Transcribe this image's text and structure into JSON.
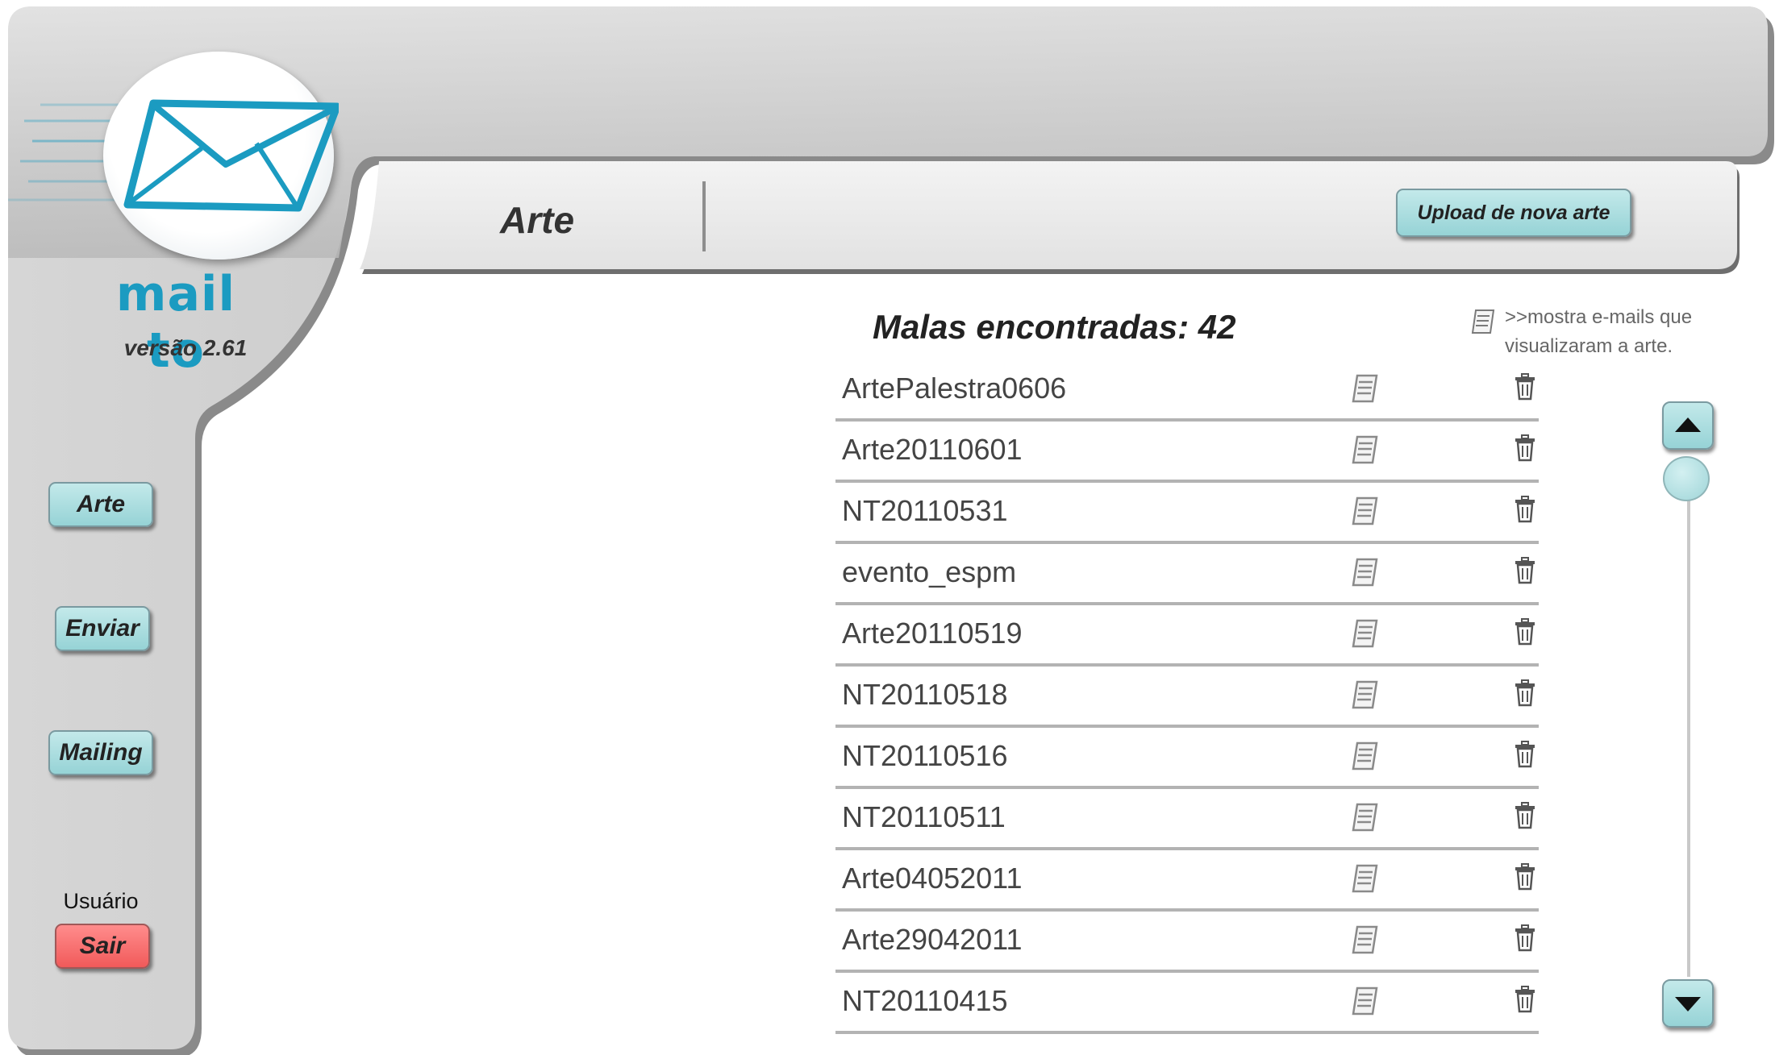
{
  "app": {
    "logo_text": "mail to",
    "version": "versão 2.61"
  },
  "header": {
    "section_title": "Arte",
    "upload_button": "Upload de nova arte"
  },
  "nav": {
    "items": [
      {
        "label": "Arte"
      },
      {
        "label": "Enviar"
      },
      {
        "label": "Mailing"
      }
    ],
    "user_label": "Usuário",
    "logout": "Sair"
  },
  "results": {
    "heading": "Malas encontradas: 42",
    "legend_line1": ">>mostra e-mails que",
    "legend_line2": "visualizaram a arte.",
    "items": [
      {
        "name": "ArtePalestra0606"
      },
      {
        "name": "Arte20110601"
      },
      {
        "name": "NT20110531"
      },
      {
        "name": "evento_espm"
      },
      {
        "name": "Arte20110519"
      },
      {
        "name": "NT20110518"
      },
      {
        "name": "NT20110516"
      },
      {
        "name": "NT20110511"
      },
      {
        "name": "Arte04052011"
      },
      {
        "name": "Arte29042011"
      },
      {
        "name": "NT20110415"
      }
    ]
  },
  "colors": {
    "frame_gray": "#c6c6c6",
    "button_teal": "#a6dcdf",
    "logout_red": "#f26464",
    "logo_blue": "#1b9bc1"
  },
  "icons": {
    "view": "document-icon",
    "delete": "trash-icon"
  }
}
